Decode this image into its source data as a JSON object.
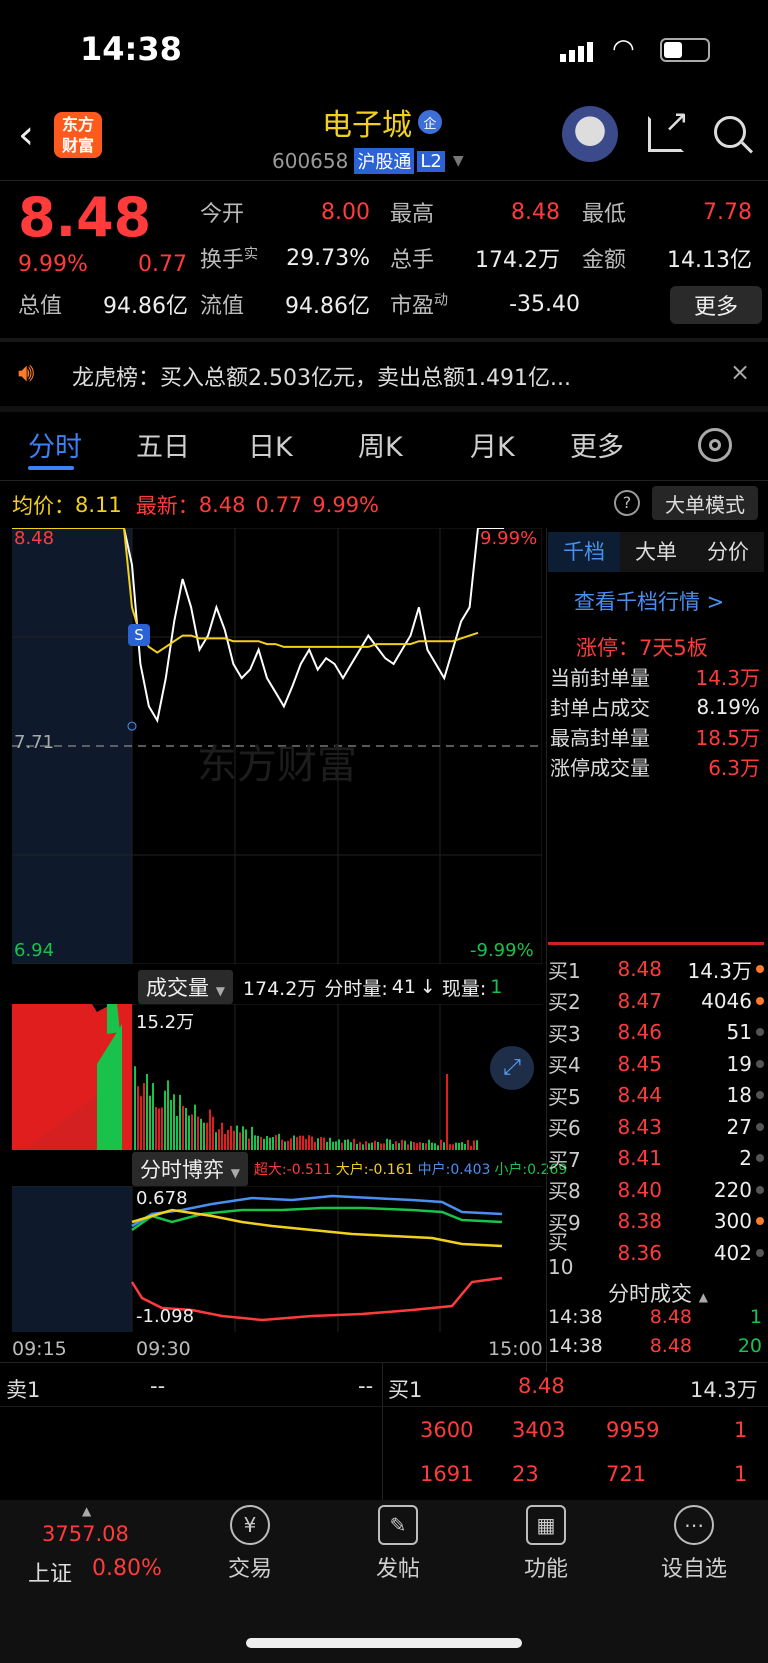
{
  "status_bar": {
    "time": "14:38"
  },
  "header": {
    "logo_text": "东方\n财富",
    "title": "电子城",
    "badge": "企",
    "code": "600658",
    "tag": "沪股通",
    "level": "L2"
  },
  "quote": {
    "price": "8.48",
    "change_pct": "9.99%",
    "change": "0.77",
    "rows": [
      [
        {
          "label": "今开",
          "value": "8.00",
          "color": "red"
        },
        {
          "label": "最高",
          "value": "8.48",
          "color": "red"
        },
        {
          "label": "最低",
          "value": "7.78",
          "color": "red"
        }
      ],
      [
        {
          "label": "换手",
          "sup": "实",
          "value": "29.73%",
          "color": "white"
        },
        {
          "label": "总手",
          "value": "174.2万",
          "color": "white"
        },
        {
          "label": "金额",
          "value": "14.13亿",
          "color": "white"
        }
      ],
      [
        {
          "label": "总值",
          "value": "94.86亿",
          "color": "white"
        },
        {
          "label": "流值",
          "value": "94.86亿",
          "color": "white"
        },
        {
          "label": "市盈",
          "sup": "动",
          "value": "-35.40",
          "color": "white"
        }
      ]
    ],
    "more_button": "更多"
  },
  "notice": {
    "text": "龙虎榜：买入总额2.503亿元，卖出总额1.491亿..."
  },
  "tabs": [
    "分时",
    "五日",
    "日K",
    "周K",
    "月K",
    "更多"
  ],
  "active_tab": 0,
  "info_line": {
    "avg_label": "均价：",
    "avg_value": "8.11",
    "latest_label": "最新：",
    "latest_value": "8.48",
    "change": "0.77",
    "pct": "9.99%",
    "mode_button": "大单模式"
  },
  "chart_data": {
    "type": "line",
    "title": "",
    "y_top": "8.48",
    "y_mid": "7.71",
    "y_bottom": "6.94",
    "pct_top": "9.99%",
    "pct_bottom": "-9.99%",
    "ylim": [
      6.94,
      8.48
    ],
    "prev_close": 7.71,
    "series": [
      {
        "values": [
          8.48,
          8.48,
          8.48,
          8.35,
          8.0,
          7.85,
          7.8,
          7.95,
          8.15,
          8.3,
          8.2,
          8.05,
          8.1,
          8.2,
          8.12,
          8.0,
          7.95,
          7.98,
          8.05,
          7.95,
          7.9,
          7.85,
          7.92,
          8.0,
          8.05,
          7.98,
          8.02,
          8.0,
          7.95,
          8.0,
          8.05,
          8.1,
          8.06,
          8.02,
          8.0,
          8.05,
          8.1,
          8.2,
          8.05,
          8.0,
          7.95,
          8.05,
          8.15,
          8.2,
          8.48
        ]
      },
      {
        "name": "均价",
        "values": [
          8.48,
          8.48,
          8.48,
          8.2,
          8.1,
          8.06,
          8.04,
          8.06,
          8.08,
          8.1,
          8.1,
          8.09,
          8.09,
          8.09,
          8.09,
          8.08,
          8.08,
          8.08,
          8.08,
          8.07,
          8.07,
          8.06,
          8.06,
          8.06,
          8.06,
          8.06,
          8.06,
          8.06,
          8.06,
          8.06,
          8.06,
          8.06,
          8.07,
          8.07,
          8.07,
          8.07,
          8.07,
          8.08,
          8.08,
          8.08,
          8.08,
          8.08,
          8.09,
          8.1,
          8.11
        ]
      }
    ]
  },
  "volume": {
    "label": "成交量",
    "total": "174.2万",
    "min_vol_label": "分时量:",
    "min_vol": "41",
    "arrow": "↓",
    "now_label": "现量:",
    "now": "1",
    "max": "15.2万"
  },
  "game": {
    "label": "分时博弈",
    "super": "超大:-0.511",
    "large": "大户:-0.161",
    "mid": "中户:0.403",
    "small": "小户:0.269",
    "top": "0.678",
    "bottom": "-1.098"
  },
  "time_axis": [
    "09:15",
    "09:30",
    "15:00"
  ],
  "side": {
    "tabs": [
      "千档",
      "大单",
      "分价"
    ],
    "link": "查看千档行情 >",
    "limit": "涨停：7天5板",
    "stats": [
      {
        "label": "当前封单量",
        "value": "14.3万",
        "color": "red"
      },
      {
        "label": "封单占成交",
        "value": "8.19%",
        "color": "white"
      },
      {
        "label": "最高封单量",
        "value": "18.5万",
        "color": "red"
      },
      {
        "label": "涨停成交量",
        "value": "6.3万",
        "color": "red"
      }
    ],
    "bids": [
      {
        "l": "买1",
        "p": "8.48",
        "v": "14.3万",
        "dot": true
      },
      {
        "l": "买2",
        "p": "8.47",
        "v": "4046",
        "dot": true
      },
      {
        "l": "买3",
        "p": "8.46",
        "v": "51",
        "dot": false
      },
      {
        "l": "买4",
        "p": "8.45",
        "v": "19",
        "dot": false
      },
      {
        "l": "买5",
        "p": "8.44",
        "v": "18",
        "dot": false
      },
      {
        "l": "买6",
        "p": "8.43",
        "v": "27",
        "dot": false
      },
      {
        "l": "买7",
        "p": "8.41",
        "v": "2",
        "dot": false
      },
      {
        "l": "买8",
        "p": "8.40",
        "v": "220",
        "dot": false
      },
      {
        "l": "买9",
        "p": "8.38",
        "v": "300",
        "dot": true
      },
      {
        "l": "买10",
        "p": "8.36",
        "v": "402",
        "dot": false
      }
    ],
    "trades_title": "分时成交",
    "trades": [
      {
        "t": "14:38",
        "p": "8.48",
        "v": "1"
      },
      {
        "t": "14:38",
        "p": "8.48",
        "v": "20"
      }
    ]
  },
  "bottom_book": {
    "sell1": "卖1",
    "sell1_p": "--",
    "sell1_v": "--",
    "buy1": "买1",
    "buy1_p": "8.48",
    "buy1_v": "14.3万",
    "row2": [
      "3600",
      "3403",
      "9959",
      "1"
    ],
    "row3": [
      "1691",
      "23",
      "721",
      "1"
    ]
  },
  "bottom_nav": {
    "index_value": "3757.08",
    "index_name": "上证",
    "index_pct": "0.80%",
    "items": [
      "交易",
      "发帖",
      "功能",
      "设自选"
    ]
  },
  "watermark": "东方财富"
}
